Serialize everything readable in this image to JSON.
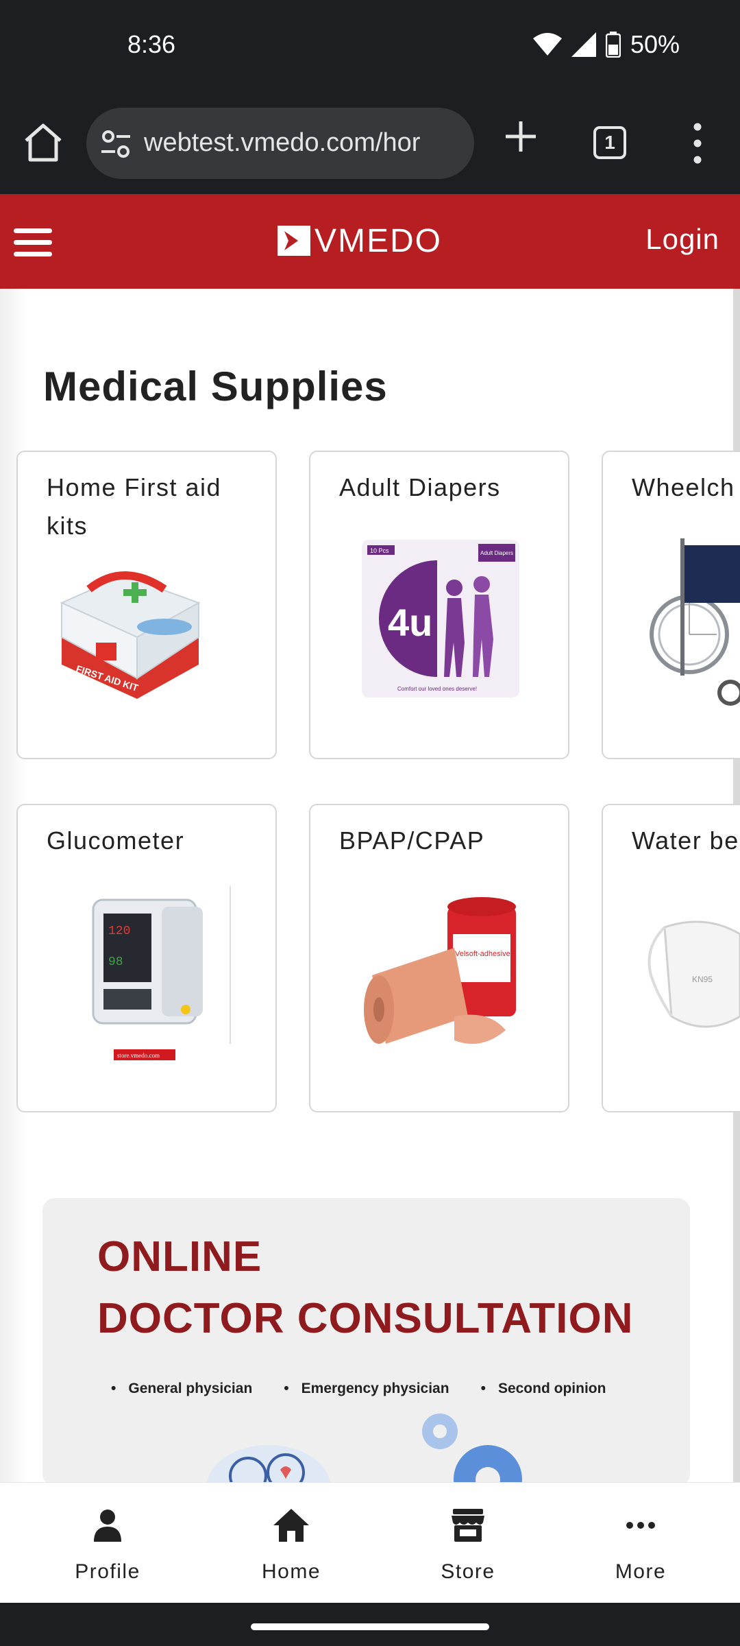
{
  "status": {
    "time": "8:36",
    "battery": "50%"
  },
  "browser": {
    "url": "webtest.vmedo.com/hor",
    "tab_count": "1"
  },
  "header": {
    "logo": "VMEDO",
    "login_label": "Login"
  },
  "section": {
    "title": "Medical Supplies"
  },
  "products": [
    {
      "title": "Home First aid kits"
    },
    {
      "title": "Adult Diapers"
    },
    {
      "title": "Wheelch"
    },
    {
      "title": "Glucometer"
    },
    {
      "title": "BPAP/CPAP"
    },
    {
      "title": "Water be"
    }
  ],
  "images": {
    "first_aid_label": "FIRST AID KIT",
    "diaper_brand": "4u",
    "diaper_pack": "10 Pcs",
    "diaper_tag": "Adult Diapers",
    "diaper_tagline": "Comfort our loved ones deserve!",
    "monitor_store": "store.vmedo.com",
    "bandage_brand": "Velsoft-adhesive",
    "mask_label": "KN95"
  },
  "promo": {
    "line1": "ONLINE",
    "line2": "DOCTOR CONSULTATION",
    "bullets": [
      "General physician",
      "Emergency physician",
      "Second opinion"
    ]
  },
  "nav": {
    "profile": "Profile",
    "home": "Home",
    "store": "Store",
    "more": "More"
  },
  "colors": {
    "brand_red": "#b71e22",
    "promo_red": "#8f1b1e"
  }
}
